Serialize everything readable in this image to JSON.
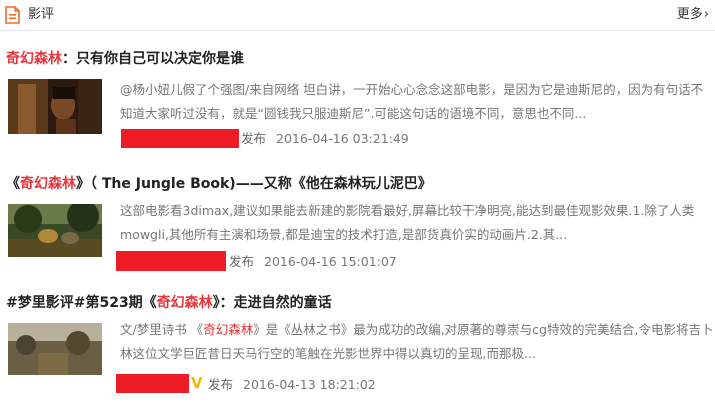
{
  "header": {
    "icon": "document-icon",
    "title": "影评",
    "more_label": "更多",
    "more_chevron": "›"
  },
  "reviews": [
    {
      "title_pre": "",
      "title_highlight": "奇幻森林",
      "title_post": "：只有你自己可以决定你是谁",
      "snippet": "@杨小妞儿假了个强图/来自网络 坦白讲，一开始心心念念这部电影，是因为它是迪斯尼的，因为有句话不知道大家听过没有，就是“圆钱我只服迪斯尼”.可能这句话的语境不同，意思也不同...",
      "publish_label": "发布",
      "publish_time": "2016-04-16 03:21:49"
    },
    {
      "title_pre": "《",
      "title_highlight": "奇幻森林",
      "title_post": "》（ The Jungle Book)——又称《他在森林玩儿泥巴》",
      "snippet": "这部电影看3dimax,建议如果能去新建的影院看最好,屏幕比较干净明亮,能达到最佳观影效果.1.除了人类mowgli,其他所有主演和场景,都是迪宝的技术打造,是部货真价实的动画片.2.其...",
      "publish_label": "发布",
      "publish_time": "2016-04-16 15:01:07"
    },
    {
      "title_pre": "#梦里影评#第523期《",
      "title_highlight": "奇幻森林",
      "title_post": "》：走进自然的童话",
      "snippet_pre": "文/梦里诗书 《",
      "snippet_highlight": "奇幻森林",
      "snippet_post": "》是《丛林之书》最为成功的改编,对原著的尊崇与cg特效的完美结合,令电影将吉卜林这位文学巨匠昔日天马行空的笔触在光影世界中得以真切的呈现,而那极...",
      "verified_badge": "V",
      "publish_label": "发布",
      "publish_time": "2016-04-13 18:21:02"
    }
  ],
  "colors": {
    "highlight": "#e8343a",
    "redaction": "#ee1c25",
    "verified": "#f5b800"
  }
}
